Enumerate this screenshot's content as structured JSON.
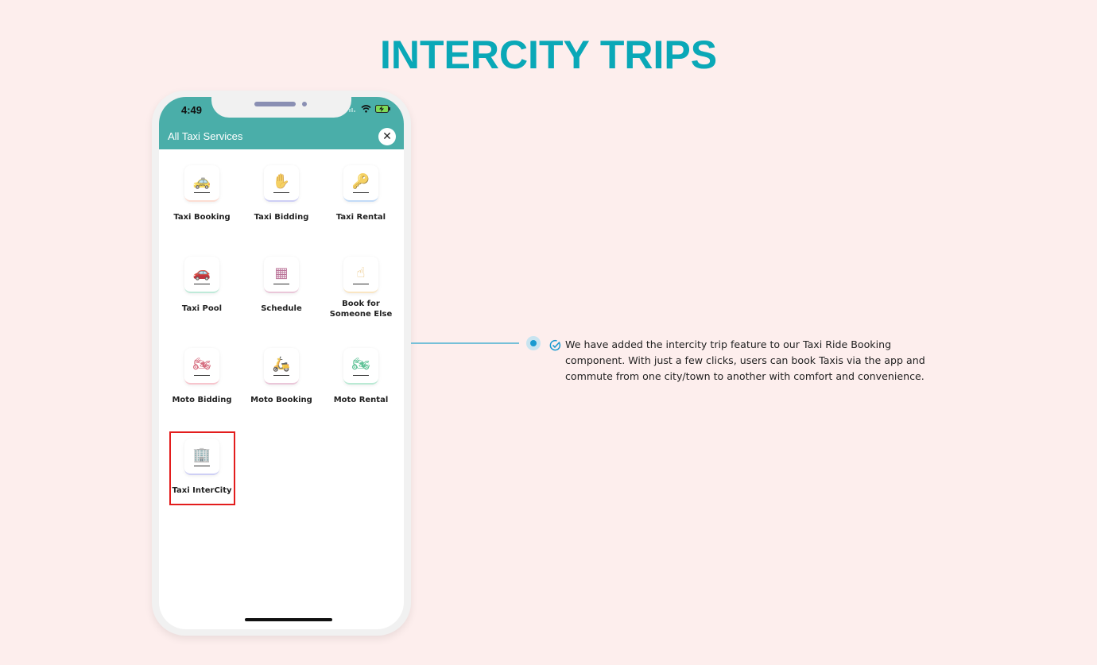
{
  "page": {
    "title": "INTERCITY TRIPS",
    "colors": {
      "background": "#fdeeed",
      "title": "#0aa8b7",
      "header": "#4aaea9",
      "highlight": "#e31d1d",
      "connector": "#76c0d8"
    }
  },
  "phone": {
    "status_bar": {
      "time": "4:49",
      "icons": [
        "signal-icon",
        "wifi-icon",
        "battery-charging-icon"
      ]
    },
    "header": {
      "title": "All Taxi Services",
      "close_icon": "close-icon"
    },
    "services": [
      {
        "label": "Taxi Booking",
        "icon": "taxi-icon",
        "color": "#f59a7c"
      },
      {
        "label": "Taxi Bidding",
        "icon": "bid-hand-icon",
        "color": "#6b6fe0"
      },
      {
        "label": "Taxi Rental",
        "icon": "car-key-hand-icon",
        "color": "#4b93e6"
      },
      {
        "label": "Taxi Pool",
        "icon": "taxi-pool-icon",
        "color": "#3fc08e"
      },
      {
        "label": "Schedule",
        "icon": "calendar-icon",
        "color": "#c0578e"
      },
      {
        "label": "Book for Someone Else",
        "label_line1": "Book for",
        "label_line2": "Someone Else",
        "icon": "hand-tap-icon",
        "color": "#f0b44a"
      },
      {
        "label": "Moto Bidding",
        "icon": "motorbike-bid-icon",
        "color": "#e8506a"
      },
      {
        "label": "Moto Booking",
        "icon": "scooter-icon",
        "color": "#c0578e"
      },
      {
        "label": "Moto Rental",
        "icon": "motorbike-hand-icon",
        "color": "#2fbf7f"
      },
      {
        "label": "Taxi InterCity",
        "icon": "building-car-icon",
        "color": "#6b6fe0",
        "highlighted": true
      }
    ]
  },
  "feature": {
    "icon": "check-circle-icon",
    "description": "We have added the intercity trip feature to our Taxi Ride Booking component. With just a few clicks, users can book Taxis via the app and commute from one city/town to another with comfort and convenience."
  }
}
